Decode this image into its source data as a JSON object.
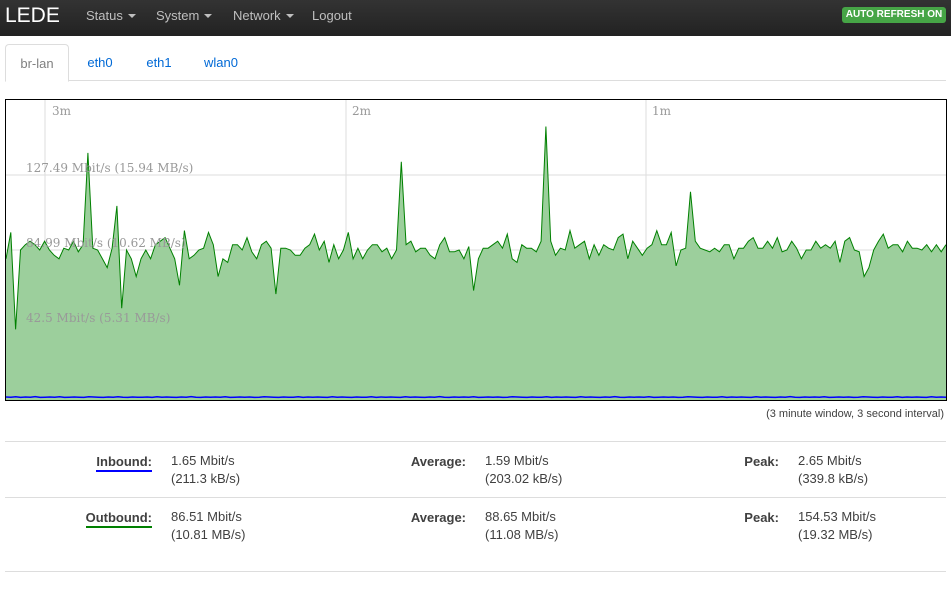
{
  "navbar": {
    "brand": "LEDE",
    "menu": [
      "Status",
      "System",
      "Network",
      "Logout"
    ],
    "auto_refresh": "AUTO REFRESH ON"
  },
  "tabs": [
    "br-lan",
    "eth0",
    "eth1",
    "wlan0"
  ],
  "active_tab": "br-lan",
  "graph": {
    "time_labels": [
      "3m",
      "2m",
      "1m"
    ],
    "rate_labels": [
      "127.49 Mbit/s (15.94 MB/s)",
      "84.99 Mbit/s (10.62 MB/s)",
      "42.5 Mbit/s (5.31 MB/s)"
    ],
    "note": "(3 minute window, 3 second interval)",
    "colors": {
      "inbound": "#0000ff",
      "outbound": "#008000",
      "outbound_fill": "#9ccf9c"
    }
  },
  "chart_data": {
    "type": "area",
    "ylim": [
      0,
      170
    ],
    "series": [
      {
        "name": "Outbound",
        "values": [
          80,
          95,
          40,
          85,
          88,
          90,
          88,
          85,
          90,
          85,
          82,
          80,
          86,
          85,
          90,
          84,
          88,
          140,
          86,
          85,
          80,
          75,
          86,
          110,
          52,
          85,
          80,
          70,
          80,
          85,
          80,
          88,
          90,
          92,
          86,
          80,
          65,
          96,
          80,
          82,
          85,
          86,
          95,
          88,
          70,
          80,
          78,
          88,
          88,
          85,
          92,
          84,
          80,
          88,
          90,
          86,
          60,
          86,
          86,
          85,
          82,
          82,
          86,
          88,
          94,
          85,
          90,
          78,
          88,
          80,
          85,
          95,
          80,
          86,
          80,
          85,
          88,
          88,
          84,
          86,
          80,
          85,
          135,
          88,
          90,
          84,
          86,
          86,
          82,
          80,
          88,
          92,
          84,
          84,
          85,
          80,
          87,
          62,
          80,
          86,
          86,
          88,
          90,
          86,
          94,
          80,
          78,
          88,
          86,
          86,
          84,
          90,
          155,
          90,
          82,
          86,
          85,
          96,
          86,
          88,
          90,
          80,
          88,
          82,
          88,
          86,
          85,
          92,
          94,
          80,
          90,
          86,
          82,
          86,
          88,
          96,
          88,
          88,
          95,
          76,
          85,
          86,
          118,
          90,
          86,
          85,
          84,
          86,
          84,
          88,
          88,
          80,
          86,
          86,
          90,
          92,
          86,
          86,
          90,
          86,
          92,
          84,
          85,
          90,
          86,
          80,
          85,
          85,
          90,
          86,
          88,
          86,
          90,
          78,
          90,
          92,
          85,
          84,
          70,
          75,
          85,
          90,
          94,
          86,
          88,
          88,
          84,
          90,
          86,
          86,
          85,
          88,
          84,
          88,
          84,
          88
        ]
      },
      {
        "name": "Inbound",
        "values": [
          1.7,
          1.6,
          1.8,
          1.5,
          1.7,
          1.6,
          1.9,
          1.5,
          1.6,
          1.7,
          1.6,
          1.8,
          1.5,
          1.6,
          1.7,
          1.6,
          1.5,
          1.8,
          1.7,
          1.6,
          1.5,
          1.7,
          1.6,
          1.8,
          1.6,
          1.5,
          1.7,
          1.6,
          1.6,
          1.7,
          1.5,
          1.8,
          1.6,
          1.7,
          1.6,
          1.5,
          1.7,
          1.6,
          1.9,
          1.6,
          1.5,
          1.7,
          1.6,
          1.7,
          1.6,
          1.8,
          1.5,
          1.6,
          1.7,
          1.6,
          1.7,
          1.5,
          1.6,
          1.8,
          1.7,
          1.6,
          1.5,
          1.7,
          1.6,
          1.6,
          1.8,
          1.5,
          1.7,
          1.6,
          1.7,
          1.6,
          1.5,
          1.8,
          1.6,
          1.7,
          1.6,
          1.5,
          1.7,
          1.6,
          1.6,
          1.8,
          1.5,
          1.7,
          1.6,
          1.7,
          1.6,
          1.5,
          1.8,
          1.6,
          1.7,
          1.6,
          1.5,
          1.7,
          1.6,
          1.9,
          1.6,
          1.5,
          1.7,
          1.6,
          1.7,
          1.6,
          1.8,
          1.5,
          1.6,
          1.7,
          1.6,
          1.7,
          1.5,
          1.6,
          1.8,
          1.7,
          1.6,
          1.5,
          1.7,
          1.6,
          1.6,
          1.8,
          1.5,
          1.7,
          1.6,
          1.7,
          1.6,
          1.5,
          1.8,
          1.6,
          1.7,
          1.6,
          1.5,
          1.7,
          1.6,
          1.9,
          1.6,
          1.5,
          1.7,
          1.6,
          1.7,
          1.6,
          1.8,
          1.5,
          1.6,
          1.7,
          1.6,
          1.7,
          1.5,
          1.6,
          1.8,
          1.7,
          1.6,
          1.5,
          1.7,
          1.6,
          1.6,
          1.8,
          1.5,
          1.7,
          1.6,
          1.7,
          1.6,
          1.5,
          1.8,
          1.6,
          1.7,
          1.6,
          1.5,
          1.7,
          1.6,
          1.9,
          1.6,
          1.5,
          1.7,
          1.6,
          1.7,
          1.6,
          1.8,
          1.5,
          1.6,
          1.7,
          1.6,
          1.7,
          1.5,
          1.6,
          1.8,
          1.7,
          1.6,
          1.5,
          1.7,
          1.6,
          1.6,
          1.8,
          1.5,
          1.7,
          1.6,
          1.7,
          1.6,
          1.5,
          1.8,
          1.6,
          1.7,
          1.6
        ]
      }
    ]
  },
  "stats": {
    "inbound": {
      "label": "Inbound:",
      "current": "1.65 Mbit/s",
      "current_bytes": "(211.3 kB/s)",
      "average_label": "Average:",
      "average": "1.59 Mbit/s",
      "average_bytes": "(203.02 kB/s)",
      "peak_label": "Peak:",
      "peak": "2.65 Mbit/s",
      "peak_bytes": "(339.8 kB/s)"
    },
    "outbound": {
      "label": "Outbound:",
      "current": "86.51 Mbit/s",
      "current_bytes": "(10.81 MB/s)",
      "average_label": "Average:",
      "average": "88.65 Mbit/s",
      "average_bytes": "(11.08 MB/s)",
      "peak_label": "Peak:",
      "peak": "154.53 Mbit/s",
      "peak_bytes": "(19.32 MB/s)"
    }
  }
}
